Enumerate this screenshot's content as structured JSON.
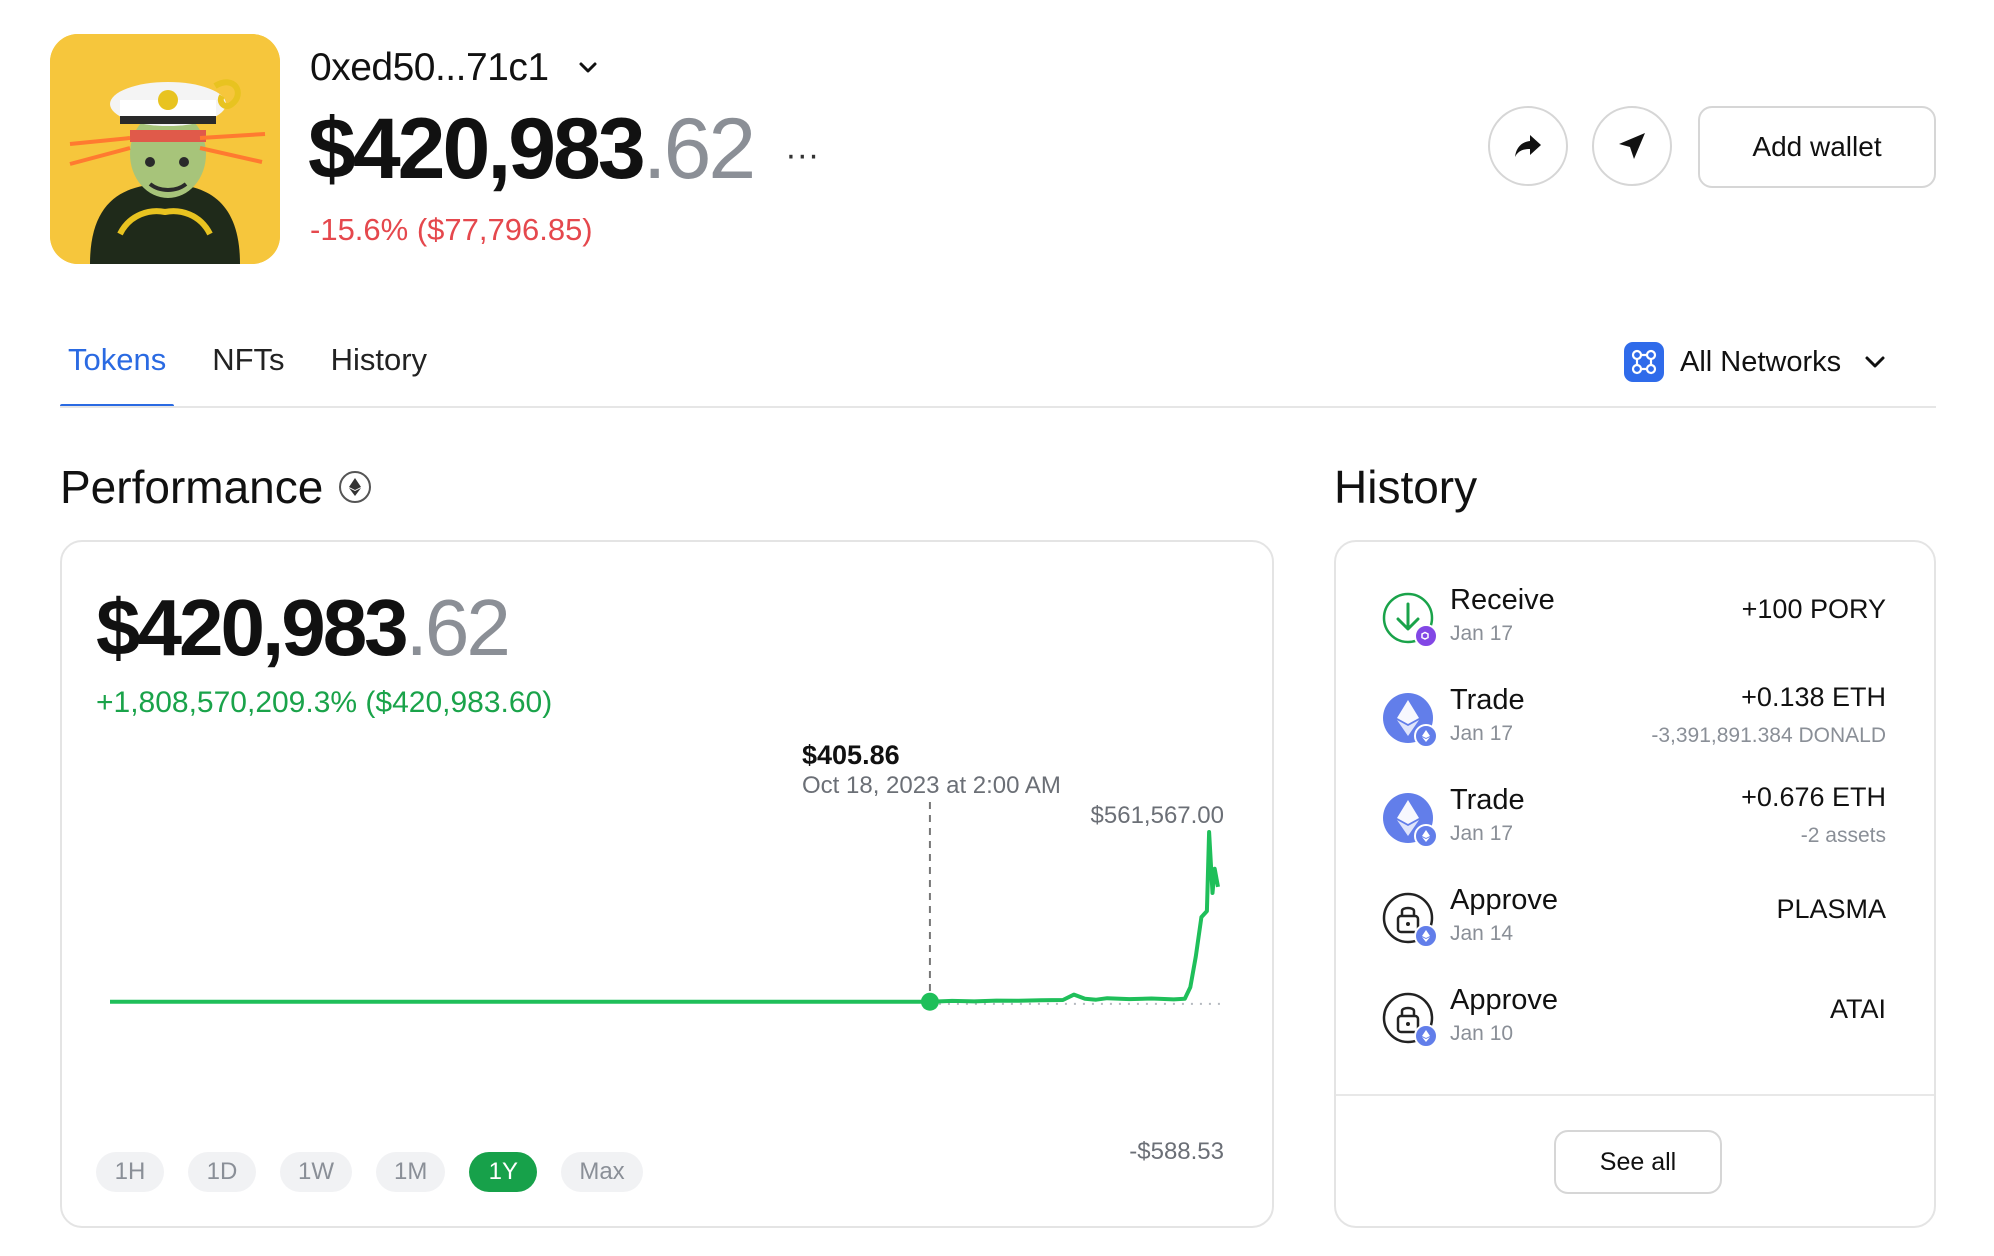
{
  "header": {
    "wallet_name": "0xed50...71c1",
    "balance_main": "$420,983",
    "balance_cents": ".62",
    "more_label": "···",
    "change": "-15.6% ($77,796.85)",
    "add_wallet_label": "Add wallet"
  },
  "tabs": [
    {
      "label": "Tokens",
      "active": true
    },
    {
      "label": "NFTs",
      "active": false
    },
    {
      "label": "History",
      "active": false
    }
  ],
  "network": {
    "label": "All Networks"
  },
  "performance": {
    "title": "Performance",
    "value_main": "$420,983",
    "value_cents": ".62",
    "change": "+1,808,570,209.3% ($420,983.60)",
    "hover_value": "$405.86",
    "hover_date": "Oct 18, 2023 at 2:00 AM",
    "max_label": "$561,567.00",
    "min_label": "-$588.53",
    "ranges": [
      {
        "label": "1H",
        "active": false
      },
      {
        "label": "1D",
        "active": false
      },
      {
        "label": "1W",
        "active": false
      },
      {
        "label": "1M",
        "active": false
      },
      {
        "label": "1Y",
        "active": true
      },
      {
        "label": "Max",
        "active": false
      }
    ]
  },
  "chart_data": {
    "type": "line",
    "x": [
      0,
      0.05,
      0.1,
      0.15,
      0.2,
      0.25,
      0.3,
      0.35,
      0.4,
      0.45,
      0.5,
      0.55,
      0.6,
      0.65,
      0.7,
      0.74,
      0.76,
      0.78,
      0.8,
      0.82,
      0.84,
      0.86,
      0.87,
      0.88,
      0.89,
      0.9,
      0.92,
      0.94,
      0.96,
      0.97,
      0.975,
      0.98,
      0.985,
      0.99,
      0.992,
      0.995,
      0.997,
      1.0
    ],
    "values": [
      0,
      0,
      0,
      0,
      0,
      0,
      0,
      0,
      0,
      0,
      0,
      0,
      0,
      0,
      0,
      405.86,
      3000,
      1500,
      4000,
      3500,
      5000,
      6000,
      24000,
      10000,
      7000,
      12000,
      9000,
      11000,
      8000,
      10000,
      48000,
      150000,
      280000,
      300000,
      561567,
      360000,
      440000,
      380000
    ],
    "ylim": [
      -588.53,
      561567.0
    ],
    "color": "#1fbf5a"
  },
  "history": {
    "title": "History",
    "items": [
      {
        "type": "Receive",
        "date": "Jan 17",
        "amount": "+100 PORY",
        "sub": "",
        "icon": "receive-icon",
        "badge": "polygon-icon"
      },
      {
        "type": "Trade",
        "date": "Jan 17",
        "amount": "+0.138 ETH",
        "sub": "-3,391,891.384 DONALD",
        "icon": "eth-icon",
        "badge": "eth-badge-icon"
      },
      {
        "type": "Trade",
        "date": "Jan 17",
        "amount": "+0.676 ETH",
        "sub": "-2 assets",
        "icon": "eth-icon",
        "badge": "eth-badge-icon"
      },
      {
        "type": "Approve",
        "date": "Jan 14",
        "amount": "PLASMA",
        "sub": "",
        "icon": "lock-icon",
        "badge": "eth-badge-icon"
      },
      {
        "type": "Approve",
        "date": "Jan 10",
        "amount": "ATAI",
        "sub": "",
        "icon": "lock-icon",
        "badge": "eth-badge-icon"
      }
    ],
    "see_all_label": "See all"
  },
  "colors": {
    "accent": "#2a6ae2",
    "negative": "#e5484d",
    "positive": "#1aa34a",
    "chart_line": "#1fbf5a",
    "avatar_bg": "#f6c63c"
  }
}
